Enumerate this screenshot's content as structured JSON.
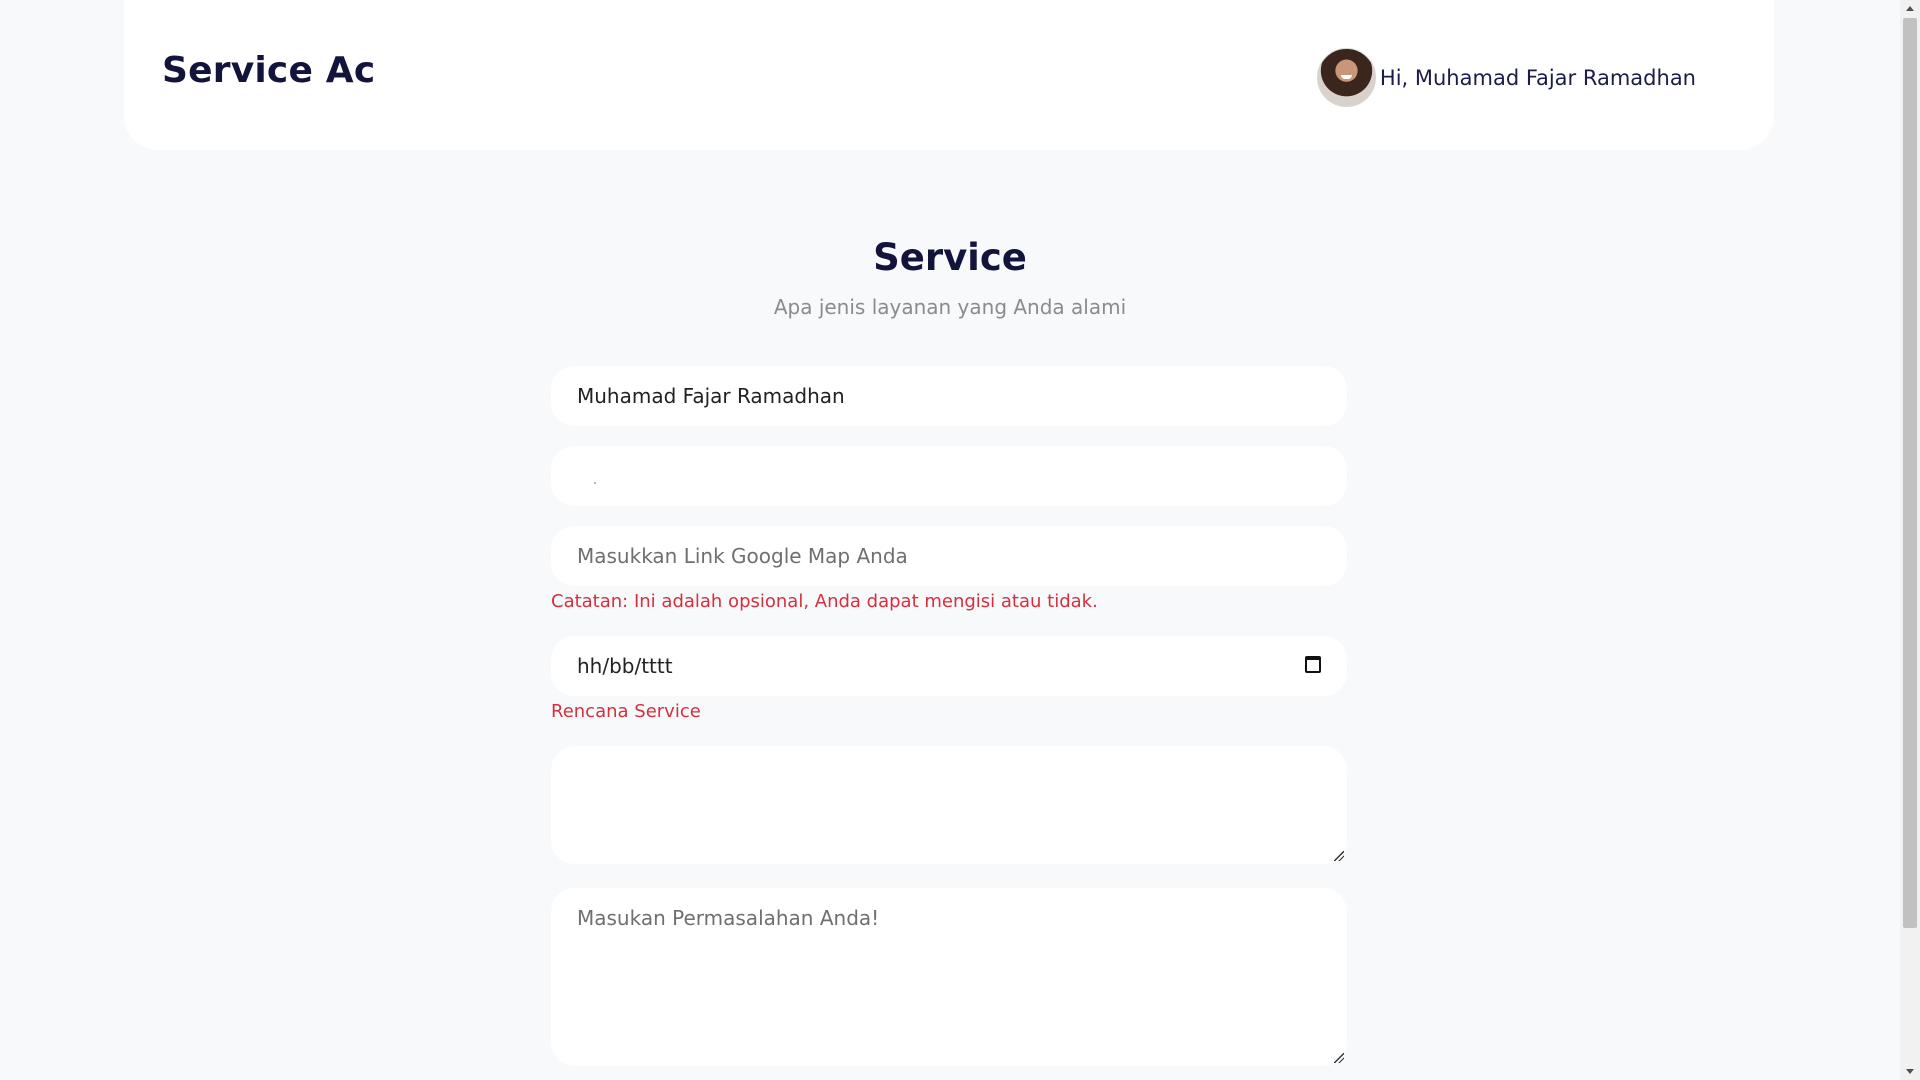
{
  "header": {
    "brand": "Service Ac",
    "greeting": "Hi, Muhamad Fajar Ramadhan"
  },
  "main": {
    "title": "Service",
    "subtitle": "Apa jenis layanan yang Anda alami"
  },
  "form": {
    "name_value": "Muhamad Fajar Ramadhan",
    "map_placeholder": "Masukkan Link Google Map Anda",
    "map_note": "Catatan: Ini adalah opsional, Anda dapat mengisi atau tidak.",
    "date_placeholder": "hh/bb/tttt",
    "date_note": "Rencana Service",
    "problem_placeholder": "Masukan Permasalahan Anda!"
  },
  "icons": {
    "calendar": "calendar-icon",
    "avatar": "user-avatar"
  },
  "colors": {
    "brand_text": "#13143b",
    "note_text": "#d62f3d",
    "background": "#f8f9fb",
    "field_background": "#ffffff"
  }
}
